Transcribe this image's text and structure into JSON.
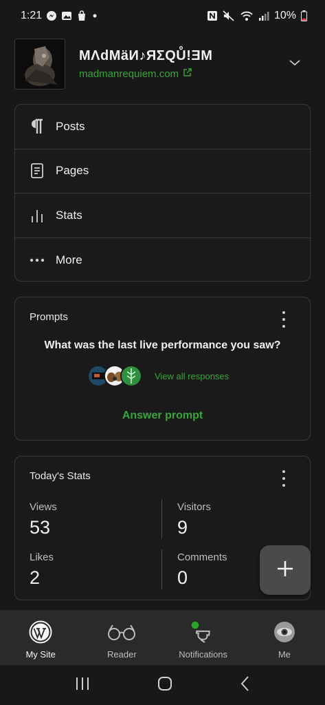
{
  "status_bar": {
    "time": "1:21",
    "battery": "10%"
  },
  "site": {
    "title": "MΛdMäИ♪ЯΣQŮ!ƎM",
    "url": "madmanrequiem.com"
  },
  "menu": {
    "items": [
      {
        "label": "Posts",
        "icon": "pilcrow-icon"
      },
      {
        "label": "Pages",
        "icon": "page-icon"
      },
      {
        "label": "Stats",
        "icon": "bar-chart-icon"
      },
      {
        "label": "More",
        "icon": "ellipsis-icon"
      }
    ]
  },
  "prompt": {
    "title": "Prompts",
    "question": "What was the last live performance you saw?",
    "view_all": "View all responses",
    "answer": "Answer prompt"
  },
  "stats": {
    "title": "Today's Stats",
    "views": {
      "label": "Views",
      "value": "53"
    },
    "visitors": {
      "label": "Visitors",
      "value": "9"
    },
    "likes": {
      "label": "Likes",
      "value": "2"
    },
    "comments": {
      "label": "Comments",
      "value": "0"
    }
  },
  "bottom_nav": {
    "items": [
      {
        "label": "My Site",
        "icon": "wordpress-icon"
      },
      {
        "label": "Reader",
        "icon": "glasses-icon"
      },
      {
        "label": "Notifications",
        "icon": "bell-icon"
      },
      {
        "label": "Me",
        "icon": "avatar-icon"
      }
    ]
  },
  "colors": {
    "accent": "#3aa53a",
    "background": "#181818",
    "card_border": "#3a3a3a"
  }
}
